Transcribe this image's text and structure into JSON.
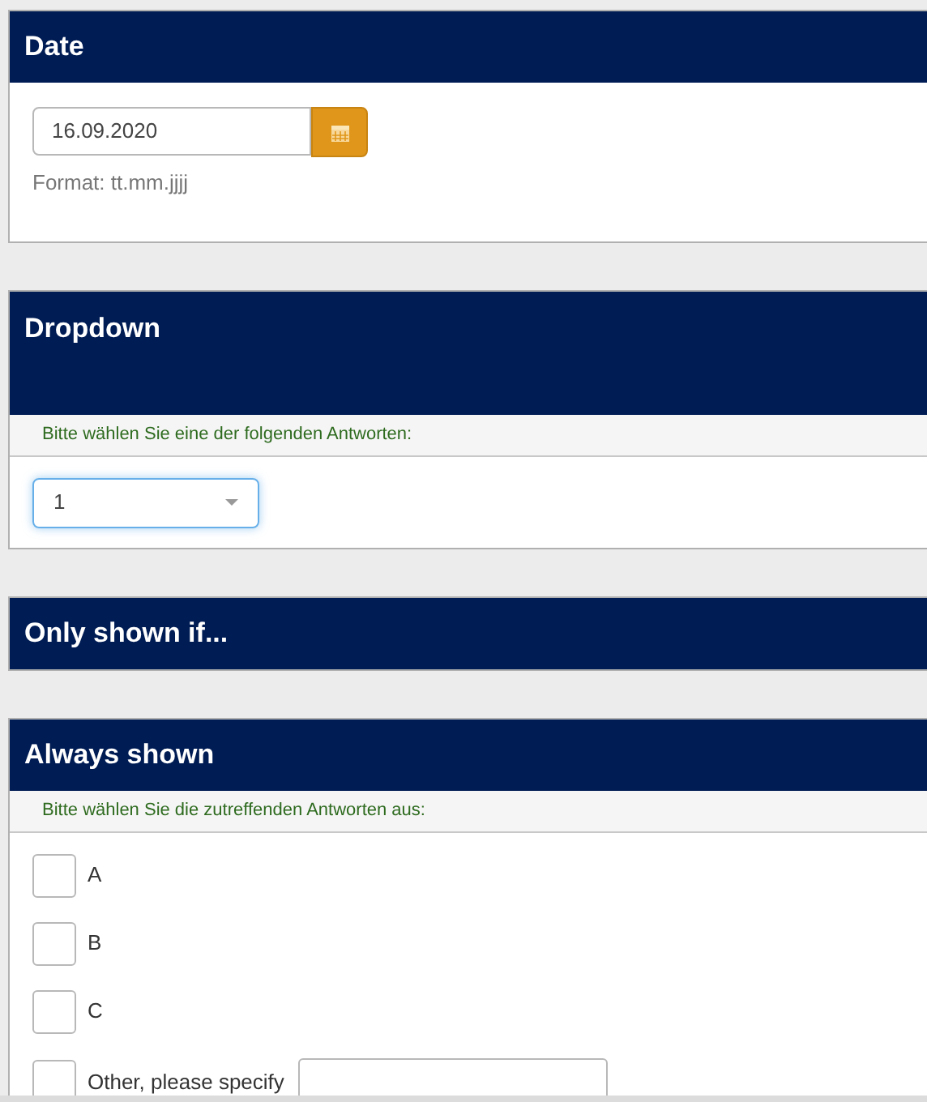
{
  "sections": [
    {
      "kind": "date",
      "title": "Date",
      "value": "16.09.2020",
      "hint": "Format: tt.mm.jjjj"
    },
    {
      "kind": "dropdown",
      "title": "Dropdown",
      "instruction": "Bitte wählen Sie eine der folgenden Antworten:",
      "value": "1"
    },
    {
      "kind": "empty",
      "title": "Only shown if..."
    },
    {
      "kind": "checkboxes",
      "title": "Always shown",
      "instruction": "Bitte wählen Sie die zutreffenden Antworten aus:",
      "options": [
        {
          "label": "A",
          "checked": false
        },
        {
          "label": "B",
          "checked": false
        },
        {
          "label": "C",
          "checked": false
        },
        {
          "label": "Other, please specify",
          "checked": false,
          "kind": "other"
        }
      ]
    }
  ]
}
